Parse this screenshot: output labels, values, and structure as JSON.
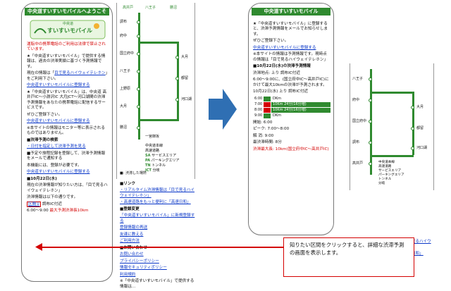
{
  "colors": {
    "brand_green": "#2f8a2f",
    "alert_red": "#d40000",
    "link_blue": "#0a37c8"
  },
  "screen1": {
    "header": "中央道すいすいモバイルへようこそ",
    "logo_small": "中央道",
    "logo_main": "すいすいモバイル",
    "warning": "運転中の携帯電話のご利用は法律で禁止されています。",
    "intro": "★「中央道すいすいモバイル」で提供する情報は、過去の渋滞実績に基づく予測情報です。",
    "live_lead": "現在の情報は「",
    "live_link": "目で見るハイウェイテレホン",
    "live_tail": "」をご利用下さい。",
    "reg_link": "中央道すいすいモバイルに登録する",
    "desc": "★「中央道すいすいモバイル」は、中央道 高井戸IC～小淵沢IC 大月JCT～河口湖間の渋滞予測情報をあなたの携帯電話に配信するサービスです。",
    "desc2": "ぜひご登録下さい。",
    "reg_link2": "中央道すいすいモバイルに登録する",
    "note": "※本サイトの情報はモニター等に表示されるものではありません。",
    "search_title": "■渋滞予測の検索",
    "search_link": "・日付を指定して渋滞予測を見る",
    "reg_section": "■予定や旅程記録を登録して、渋滞予測情報をメールで通知する",
    "reg_desc": "本機能には、登録が必要です。",
    "reg_link3": "中央道すいすいモバイルに登録する",
    "date": "■10月22日(水)",
    "date_note": "現在の渋滞情報が知りたい方は、「目で見るハイウェイテレホン」",
    "sect_note": "渋滞情報は以下の通りです。",
    "section_link": "区間①",
    "section_name": "調布IC付近",
    "time": "6:00～9:00",
    "max": "最大予測渋滞長10km"
  },
  "map1": {
    "top_labels": [
      "高井戸",
      "八王子",
      "勝沼"
    ],
    "left_stations": [
      "調布",
      "府中",
      "国立府中",
      "八王子",
      "上野原",
      "大月",
      "勝沼",
      "一宮御坂"
    ],
    "right_stations": [
      "大月",
      "都留",
      "河口湖"
    ],
    "legend": [
      "中央道本線",
      "高速道路",
      "サービスエリア",
      "パーキングエリア",
      "トンネル",
      "分岐"
    ],
    "legend_keys": [
      "SA",
      "PA",
      "TN",
      "JCT"
    ],
    "footer": "■: 渋滞した場所"
  },
  "menu": {
    "link_title": "■リンク",
    "realtime": "・リアルタイム渋滞情報は「目で見るハイウェイテレホン」",
    "highway": "・高速道路をもっと便利に「高速日和」",
    "register_title": "■登録変更",
    "reg_items": [
      "「中央道すいすいモバイル」に新規登録する",
      "登録情報の再送",
      "友達に教える",
      "ご利用方法"
    ],
    "info_title": "■お問い合わせ",
    "info_items": [
      "お問い合わせ",
      "プライバシーポリシー",
      "情報セキュリティポリシー",
      "利用規約"
    ],
    "footer": "※「中央道すいすいモバイル」で提供する情報は…"
  },
  "screen2": {
    "header": "中央道すいすいモバイル",
    "intro": "★「中央道すいすいモバイル」に登録すると、渋滞予測情報をメールでお知らせします。",
    "desc": "ぜひご登録下さい。",
    "reg_link": "中央道すいすいモバイルに登録する",
    "note": "※本サイトの情報は予測情報です。現時点の情報は「目で見るハイウェイテレホン」",
    "date": "■10月22日(水)の渋滞予測情報",
    "route": "渋滞地点: 上り 調布IC付近",
    "range": "6:00～9:00に、(国立府中IC～高井戸IC)にかけて最大10kmの渋滞が予測されます。",
    "date2": "10月22日(水) 上り 調布IC付近",
    "table": [
      {
        "time": "6:00",
        "val": "DKm"
      },
      {
        "time": "7:00",
        "val": "10Km 24分(16分増)"
      },
      {
        "time": "8:00",
        "val": "10Km 24分(16分増)"
      },
      {
        "time": "9:00",
        "val": "DKm"
      }
    ],
    "start": "開始: 6:00",
    "peak": "ピーク: 7:00～8:00",
    "end": "解 消: 9:00",
    "len": "最渋滞時間: 8分",
    "max": "渋滞最大長: 10km(国立府中IC～高井戸IC)"
  },
  "map2": {
    "stations": [
      "八王子",
      "府中",
      "国立府中",
      "調布",
      "高井戸",
      "大月",
      "都留",
      "河口湖"
    ],
    "legend": [
      "中央道本線",
      "高速道路",
      "サービスエリア",
      "パーキングエリア",
      "トンネル",
      "分岐"
    ],
    "realtime": "・リアルタイム渋滞情報は「目で見るハイウェイテレホン」",
    "highway": "・高速道路をもっと便利に「高速日和」",
    "back": "戻る",
    "top": "TOPへ"
  },
  "callout": "知りたい区間をクリックすると、詳細な渋滞予測の画面を表示します。"
}
